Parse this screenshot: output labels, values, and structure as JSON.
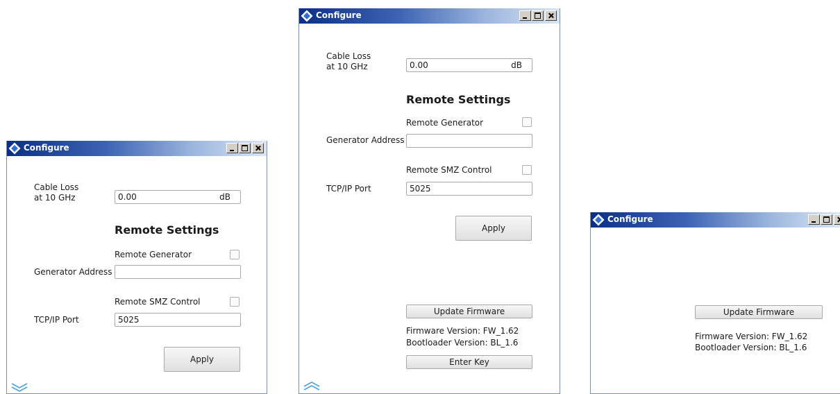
{
  "colors": {
    "title_gradient_start": "#0b2f86",
    "title_gradient_end": "#dbe6f4",
    "window_border": "#7f8fa6",
    "chevron": "#4aa3df"
  },
  "icons": {
    "app": "rs-diamond-icon",
    "minimize": "minimize-icon",
    "maximize": "maximize-icon",
    "close": "close-icon",
    "expand": "chevron-down-double-icon",
    "collapse": "chevron-up-double-icon"
  },
  "window1": {
    "title": "Configure",
    "cable_loss_label": "Cable Loss\nat 10 GHz",
    "cable_loss_value": "0.00",
    "cable_loss_unit": "dB",
    "remote_settings_heading": "Remote Settings",
    "remote_generator_label": "Remote Generator",
    "remote_generator_checked": false,
    "generator_address_label": "Generator Address",
    "generator_address_value": "",
    "remote_smz_label": "Remote SMZ Control",
    "remote_smz_checked": false,
    "tcp_port_label": "TCP/IP Port",
    "tcp_port_value": "5025",
    "apply_label": "Apply"
  },
  "window2": {
    "title": "Configure",
    "cable_loss_label": "Cable Loss\nat 10 GHz",
    "cable_loss_value": "0.00",
    "cable_loss_unit": "dB",
    "remote_settings_heading": "Remote Settings",
    "remote_generator_label": "Remote Generator",
    "remote_generator_checked": false,
    "generator_address_label": "Generator Address",
    "generator_address_value": "",
    "remote_smz_label": "Remote SMZ Control",
    "remote_smz_checked": false,
    "tcp_port_label": "TCP/IP Port",
    "tcp_port_value": "5025",
    "apply_label": "Apply",
    "update_firmware_label": "Update Firmware",
    "firmware_version": "Firmware Version: FW_1.62",
    "bootloader_version": "Bootloader Version: BL_1.6",
    "enter_key_label": "Enter Key"
  },
  "window3": {
    "title": "Configure",
    "update_firmware_label": "Update Firmware",
    "firmware_version": "Firmware Version: FW_1.62",
    "bootloader_version": "Bootloader Version: BL_1.6"
  }
}
